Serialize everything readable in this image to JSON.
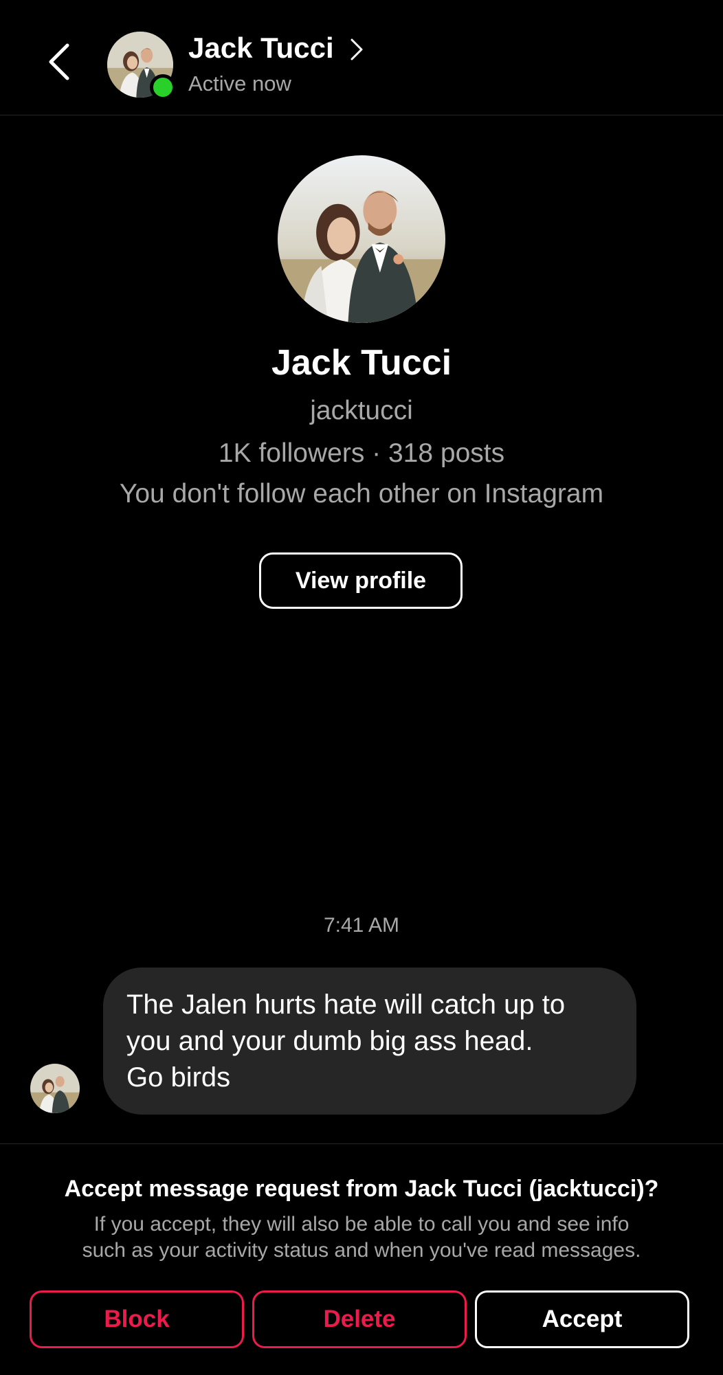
{
  "header": {
    "name": "Jack Tucci",
    "status": "Active now"
  },
  "profile": {
    "name": "Jack Tucci",
    "handle": "jacktucci",
    "stats": "1K followers · 318 posts",
    "relation": "You don't follow each other on Instagram",
    "view_profile_label": "View profile"
  },
  "thread": {
    "timestamp": "7:41 AM",
    "messages": [
      {
        "lines": [
          "The Jalen hurts hate will catch up to",
          "you and your dumb big ass head.",
          "Go birds"
        ]
      }
    ]
  },
  "request": {
    "title": "Accept message request from Jack Tucci (jacktucci)?",
    "body_line1": "If you accept, they will also be able to call you and see info",
    "body_line2": "such as your activity status and when you've read messages.",
    "block_label": "Block",
    "delete_label": "Delete",
    "accept_label": "Accept"
  },
  "colors": {
    "background": "#000000",
    "bubble": "#262626",
    "secondary_text": "#a8a8a8",
    "danger": "#ed1b4b",
    "active_dot": "#2ad02a"
  },
  "icons": {
    "back": "chevron-left-icon",
    "header_chevron": "chevron-right-icon",
    "active": "active-dot-icon"
  }
}
